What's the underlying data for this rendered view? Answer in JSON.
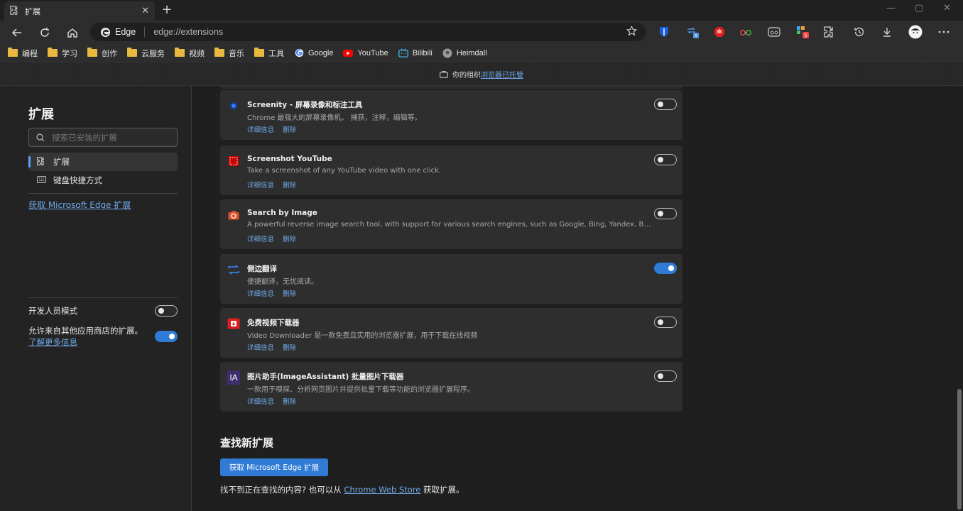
{
  "tab": {
    "title": "扩展",
    "close": "✕",
    "new": "+"
  },
  "window": {
    "minimize": "—",
    "maximize": "▢",
    "close": "✕"
  },
  "omnibox": {
    "site_label": "Edge",
    "url": "edge://extensions"
  },
  "bookmarks": [
    {
      "label": "编程",
      "type": "folder"
    },
    {
      "label": "学习",
      "type": "folder"
    },
    {
      "label": "创作",
      "type": "folder"
    },
    {
      "label": "云服务",
      "type": "folder"
    },
    {
      "label": "视频",
      "type": "folder"
    },
    {
      "label": "音乐",
      "type": "folder"
    },
    {
      "label": "工具",
      "type": "folder"
    },
    {
      "label": "Google",
      "type": "google"
    },
    {
      "label": "YouTube",
      "type": "youtube"
    },
    {
      "label": "Bilibili",
      "type": "bilibili"
    },
    {
      "label": "Heimdall",
      "type": "heimdall"
    }
  ],
  "banner": {
    "text": "你的组织",
    "link": "浏览器已托管"
  },
  "sidebar": {
    "title": "扩展",
    "search_placeholder": "搜索已安装的扩展",
    "items": [
      {
        "label": "扩展",
        "active": true
      },
      {
        "label": "键盘快捷方式",
        "active": false
      }
    ],
    "store_link": "获取 Microsoft Edge 扩展",
    "dev_mode_label": "开发人员模式",
    "dev_mode_on": false,
    "allow_label": "允许来自其他应用商店的扩展。",
    "allow_link": "了解更多信息",
    "allow_on": true
  },
  "extensions": [
    {
      "name": "Screenity - 屏幕录像和标注工具",
      "desc": "Chrome 最强大的屏幕录像机。 捕获，注释，编辑等。",
      "details": "详细信息",
      "remove": "删除",
      "enabled": false,
      "icon": "screenity-icon"
    },
    {
      "name": "Screenshot YouTube",
      "desc": "Take a screenshot of any YouTube video with one click.",
      "details": "详细信息",
      "remove": "删除",
      "enabled": false,
      "icon": "screenshot-youtube-icon"
    },
    {
      "name": "Search by Image",
      "desc": "A powerful reverse image search tool, with support for various search engines, such as Google, Bing, Yandex, Baidu and TinEye.",
      "details": "详细信息",
      "remove": "删除",
      "enabled": false,
      "icon": "camera-icon"
    },
    {
      "name": "侧边翻译",
      "desc": "便捷翻译，无忧阅读。",
      "details": "详细信息",
      "remove": "删除",
      "enabled": true,
      "icon": "translate-icon"
    },
    {
      "name": "免费视频下载器",
      "desc": "Video Downloader 是一款免费且实用的浏览器扩展，用于下载在线视频",
      "details": "详细信息",
      "remove": "删除",
      "enabled": false,
      "icon": "video-download-icon"
    },
    {
      "name": "图片助手(ImageAssistant) 批量图片下载器",
      "desc": "一款用于嗅探、分析网页图片并提供批量下载等功能的浏览器扩展程序。",
      "details": "详细信息",
      "remove": "删除",
      "enabled": false,
      "icon": "image-assistant-icon",
      "icon_text": "IA"
    }
  ],
  "find": {
    "title": "查找新扩展",
    "button": "获取 Microsoft Edge 扩展",
    "text_before": "找不到正在查找的内容? 也可以从 ",
    "link": "Chrome Web Store",
    "text_after": " 获取扩展。"
  },
  "colors": {
    "accent": "#2f7bd6",
    "link": "#6fa9e8",
    "folder": "#e8b93e"
  }
}
